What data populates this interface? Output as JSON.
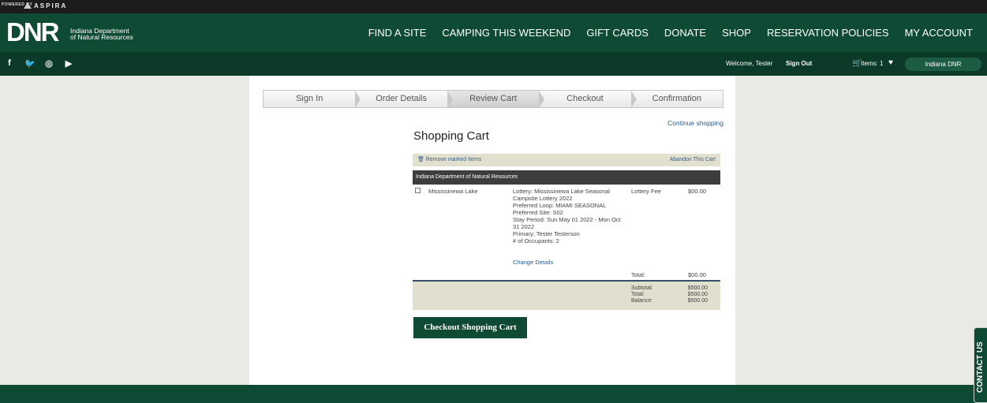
{
  "topbar": {
    "powered_by": "POWERED BY",
    "brand": "ASPIRA"
  },
  "header": {
    "logo": "DNR",
    "logo_sub_line1": "Indiana Department",
    "logo_sub_line2": "of Natural Resources",
    "nav": [
      "FIND A SITE",
      "CAMPING THIS WEEKEND",
      "GIFT CARDS",
      "DONATE",
      "SHOP",
      "RESERVATION POLICIES",
      "MY ACCOUNT"
    ]
  },
  "subheader": {
    "social": {
      "facebook": "f",
      "twitter": "🐦",
      "instagram": "◎",
      "youtube": "▶"
    },
    "welcome": "Welcome, Tester",
    "sign_out": "Sign Out",
    "cart_icon": "🛒",
    "items": "Items: 1",
    "heart": "♥",
    "agency": "Indiana DNR"
  },
  "steps": [
    "Sign In",
    "Order Details",
    "Review Cart",
    "Checkout",
    "Confirmation"
  ],
  "active_step": "Review Cart",
  "cart": {
    "continue_shopping": "Continue shopping",
    "title": "Shopping Cart",
    "remove_marked": "Remove marked Items",
    "remove_icon": "🗑",
    "abandon": "Abandon This Cart",
    "organization": "Indiana Department of Natural Resources",
    "item": {
      "name": "Mississinewa Lake",
      "details": [
        "Lottery: Mississinewa Lake Seasonal",
        "Campsite Lottery 2022",
        "Preferred Loop: MIAMI SEASONAL",
        "Preferred Site: S02",
        "Stay Period: Sun May 01 2022 - Mon Oct",
        "31 2022",
        "Primary: Tester Testerson",
        "# of Occupants: 2"
      ],
      "change_details": "Change Details",
      "fee_label": "Lottery Fee",
      "fee_amount": "$00.00"
    },
    "total_label": "Total:",
    "total_amount": "$00.00",
    "summary": {
      "subtotal_label": "Subtotal:",
      "total_label": "Total:",
      "balance_label": "Balance:",
      "subtotal": "$500.00",
      "total": "$500.00",
      "balance": "$500.00"
    },
    "checkout_button": "Checkout Shopping Cart"
  },
  "contact_us": "CONTACT US",
  "colors": {
    "brand_green": "#0f4a34",
    "dark_green": "#0b3b28",
    "link_blue": "#2a5b8f",
    "summary_bg": "#e1e0cf"
  }
}
